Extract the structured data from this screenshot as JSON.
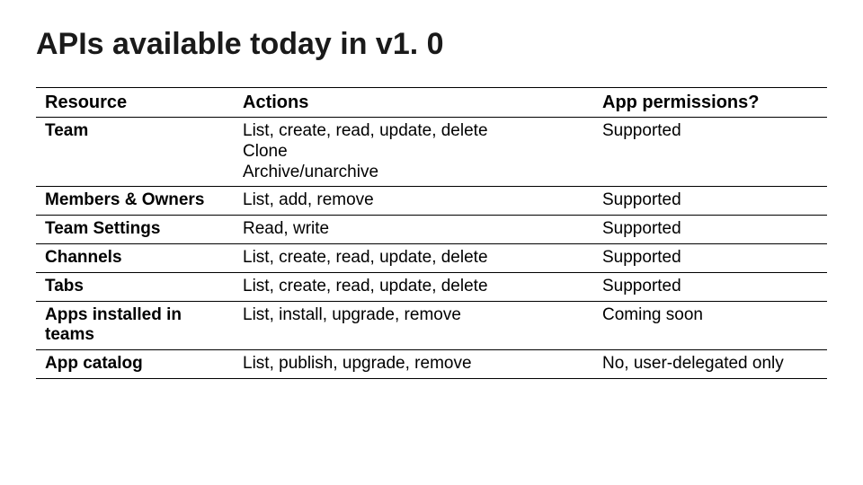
{
  "title": "APIs available today in v1. 0",
  "columns": {
    "resource": "Resource",
    "actions": "Actions",
    "permissions": "App permissions?"
  },
  "rows": [
    {
      "resource": "Team",
      "action_lines": [
        "List, create, read, update, delete",
        "Clone",
        "Archive/unarchive"
      ],
      "permissions": "Supported"
    },
    {
      "resource": "Members & Owners",
      "action_lines": [
        "List, add, remove"
      ],
      "permissions": "Supported"
    },
    {
      "resource": "Team Settings",
      "action_lines": [
        "Read, write"
      ],
      "permissions": "Supported"
    },
    {
      "resource": "Channels",
      "action_lines": [
        "List, create, read, update, delete"
      ],
      "permissions": "Supported"
    },
    {
      "resource": "Tabs",
      "action_lines": [
        "List, create, read, update, delete"
      ],
      "permissions": "Supported"
    },
    {
      "resource": "Apps installed in teams",
      "action_lines": [
        "List, install, upgrade, remove"
      ],
      "permissions": "Coming soon"
    },
    {
      "resource": "App catalog",
      "action_lines": [
        "List, publish, upgrade, remove"
      ],
      "permissions": "No, user-delegated only"
    }
  ]
}
